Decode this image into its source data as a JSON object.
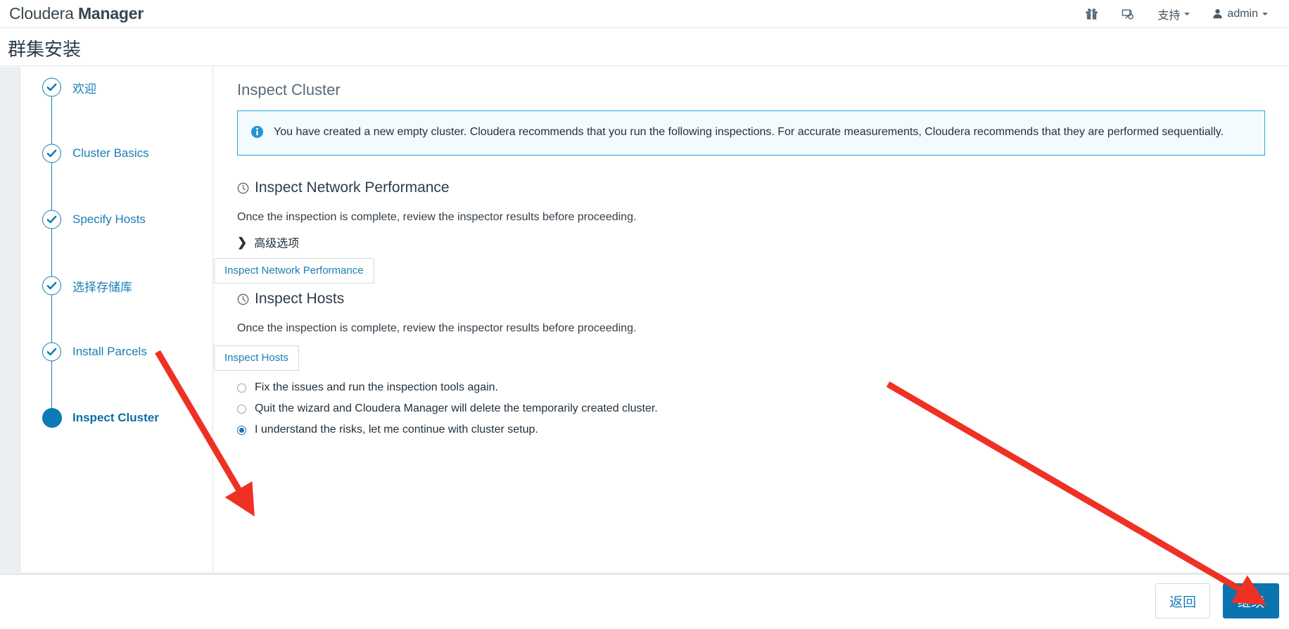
{
  "navbar": {
    "brand_light": "Cloudera ",
    "brand_bold": "Manager",
    "gift_icon": "gift-icon",
    "parcel_icon": "parcel-icon",
    "support_label": "支持",
    "user_label": "admin"
  },
  "page": {
    "title": "群集安装"
  },
  "steps": [
    {
      "label": "欢迎",
      "state": "done"
    },
    {
      "label": "Cluster Basics",
      "state": "done"
    },
    {
      "label": "Specify Hosts",
      "state": "done"
    },
    {
      "label": "选择存储库",
      "state": "done"
    },
    {
      "label": "Install Parcels",
      "state": "done"
    },
    {
      "label": "Inspect Cluster",
      "state": "active"
    }
  ],
  "content": {
    "title": "Inspect Cluster",
    "banner": {
      "icon": "info-icon",
      "text": "You have created a new empty cluster. Cloudera recommends that you run the following inspections. For accurate measurements, Cloudera recommends that they are performed sequentially."
    },
    "sections": [
      {
        "icon": "clock-icon",
        "heading": "Inspect Network Performance",
        "description": "Once the inspection is complete, review the inspector results before proceeding.",
        "advanced_toggle": "高级选项",
        "advanced_chevron": "chevron-right-icon",
        "button": "Inspect Network Performance"
      },
      {
        "icon": "clock-icon",
        "heading": "Inspect Hosts",
        "description": "Once the inspection is complete, review the inspector results before proceeding.",
        "button": "Inspect Hosts"
      }
    ],
    "radios": [
      {
        "label": "Fix the issues and run the inspection tools again.",
        "checked": false
      },
      {
        "label": "Quit the wizard and Cloudera Manager will delete the temporarily created cluster.",
        "checked": false
      },
      {
        "label": "I understand the risks, let me continue with cluster setup.",
        "checked": true
      }
    ]
  },
  "footer": {
    "back_label": "返回",
    "continue_label": "继续"
  },
  "colors": {
    "accent_blue": "#0b74ae",
    "link_blue": "#1a7eb5",
    "banner_border": "#27a8e0",
    "banner_bg": "#f4fbfe",
    "annotation_red": "#ef3124",
    "page_bg": "#eceff1"
  }
}
